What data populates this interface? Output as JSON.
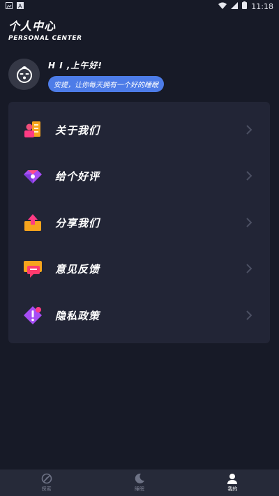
{
  "status_bar": {
    "time": "11:18"
  },
  "header": {
    "title": "个人中心",
    "subtitle": "PERSONAL CENTER"
  },
  "profile": {
    "greeting": "H I ,上午好!",
    "tagline": "安提，让你每天拥有一个好的睡眠"
  },
  "menu": {
    "items": [
      {
        "label": "关于我们",
        "icon": "about-us-icon"
      },
      {
        "label": "给个好评",
        "icon": "diamond-rating-icon"
      },
      {
        "label": "分享我们",
        "icon": "share-box-icon"
      },
      {
        "label": "意见反馈",
        "icon": "feedback-chat-icon"
      },
      {
        "label": "隐私政策",
        "icon": "privacy-warning-icon"
      }
    ]
  },
  "tabbar": {
    "tabs": [
      {
        "label": "探索",
        "icon": "explore-icon",
        "active": false
      },
      {
        "label": "睡眠",
        "icon": "moon-icon",
        "active": false
      },
      {
        "label": "我的",
        "icon": "person-icon",
        "active": true
      }
    ]
  },
  "colors": {
    "background": "#171a27",
    "card": "#222536",
    "accent": "#4d7ce8",
    "tabbar": "#262a39"
  }
}
